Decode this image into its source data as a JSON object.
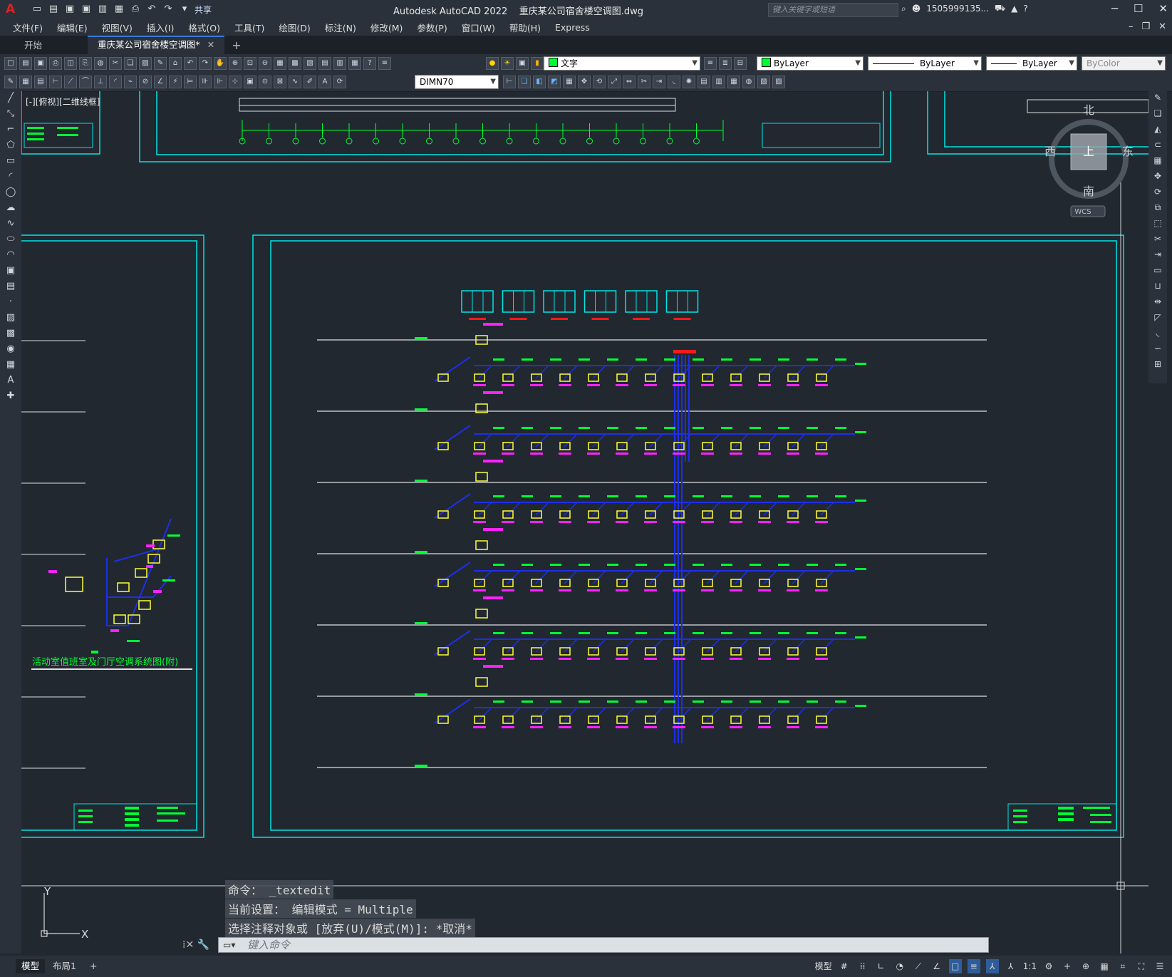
{
  "title_bar": {
    "app_title": "Autodesk AutoCAD 2022",
    "file_name": "重庆某公司宿舍楼空调图.dwg",
    "share_label": "共享",
    "search_placeholder": "键入关键字或短语",
    "user": "1505999135...",
    "logo": "A"
  },
  "menu": {
    "items": [
      "文件(F)",
      "编辑(E)",
      "视图(V)",
      "插入(I)",
      "格式(O)",
      "工具(T)",
      "绘图(D)",
      "标注(N)",
      "修改(M)",
      "参数(P)",
      "窗口(W)",
      "帮助(H)",
      "Express"
    ]
  },
  "tabs": {
    "start": "开始",
    "active": "重庆某公司宿舍楼空调图*"
  },
  "toolbar": {
    "layer_name": "文字",
    "color": "ByLayer",
    "linetype": "ByLayer",
    "lineweight": "ByLayer",
    "plotstyle": "ByColor",
    "dimstyle": "DIMN70"
  },
  "viewport": {
    "label": "[-][俯视][二维线框]"
  },
  "viewcube": {
    "north": "北",
    "south": "南",
    "east": "东",
    "west": "西",
    "top_face": "上",
    "wcs": "WCS"
  },
  "drawing": {
    "system_caption": "活动室值班室及门厅空调系统图(附)"
  },
  "ucs": {
    "x": "X",
    "y": "Y"
  },
  "command": {
    "history": [
      "命令： _textedit",
      "当前设置： 编辑模式 = Multiple",
      "选择注释对象或 [放弃(U)/模式(M)]: *取消*"
    ],
    "placeholder": "键入命令"
  },
  "status": {
    "model_tab": "模型",
    "layout_tab": "布局1",
    "model_label": "模型",
    "scale": "1:1"
  },
  "colors": {
    "background": "#212830",
    "frame": "#00e5e5",
    "pipe": "#1f2fe6",
    "unit": "#ffff33",
    "label": "#00ff33",
    "tag": "#ff22ff",
    "red": "#ff1a1a"
  }
}
